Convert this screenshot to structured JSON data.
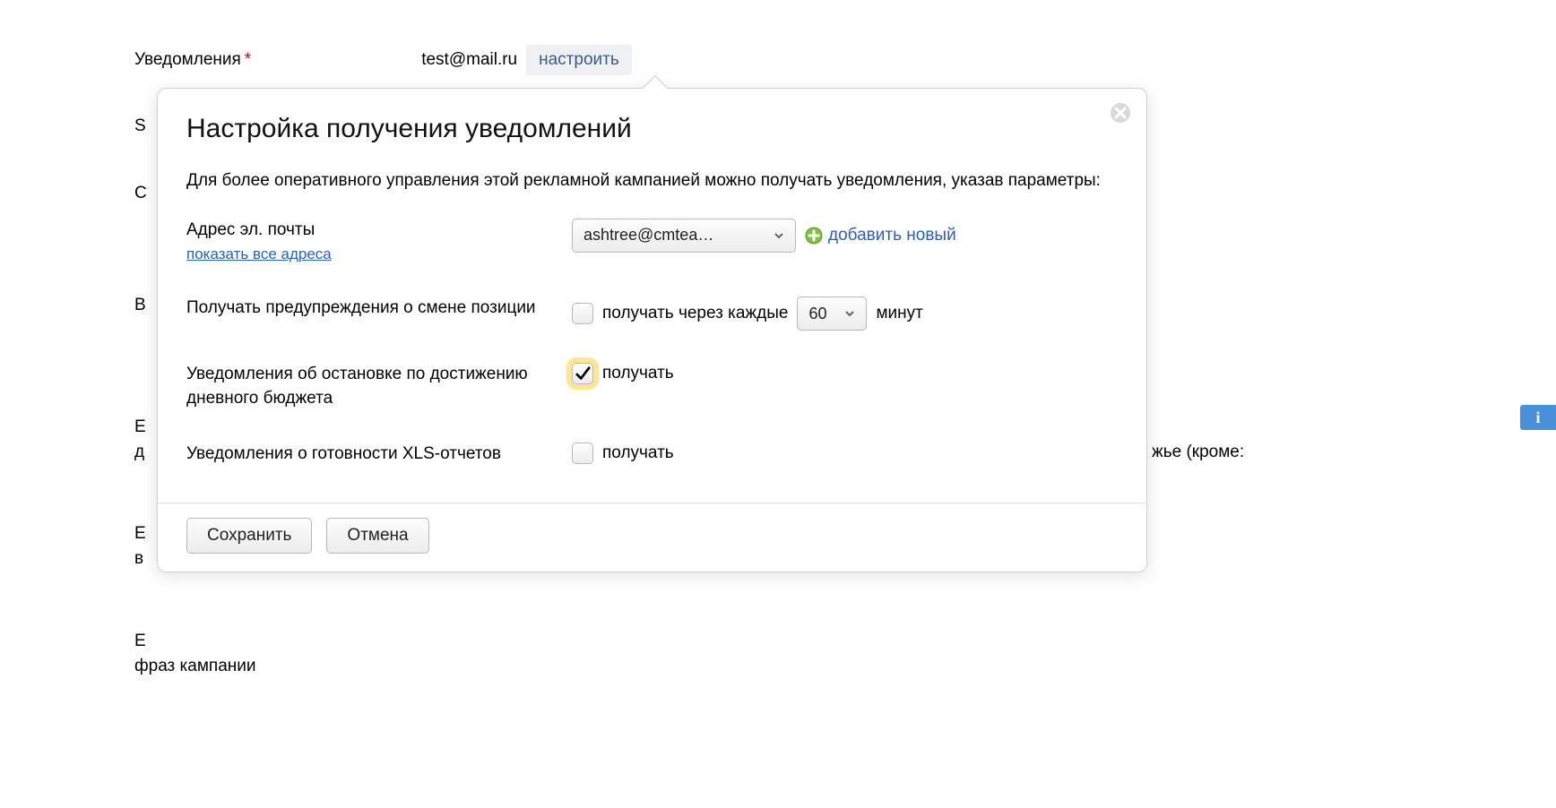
{
  "background": {
    "notifications_label": "Уведомления",
    "notifications_email": "test@mail.ru",
    "configure_btn": "настроить",
    "row_s": "S",
    "row_c": "С",
    "row_b": "В",
    "row_e1a": "Е",
    "row_e1b": "д",
    "row_e2a": "Е",
    "row_e2b": "в",
    "row_e3a": "Е",
    "row_e3b": "фраз кампании",
    "trail_text": "жье (кроме:",
    "info_badge": "i"
  },
  "modal": {
    "title": "Настройка получения уведомлений",
    "description": "Для более оперативного управления этой рекламной кампанией можно получать уведомления, указав параметры:",
    "email_label": "Адрес эл. почты",
    "show_all": "показать все адреса",
    "email_select": "ashtree@cmtea…",
    "add_new": "добавить новый",
    "position_label": "Получать предупреждения о смене позиции",
    "position_chk_label": "получать через каждые",
    "interval_value": "60",
    "interval_unit": "минут",
    "budget_label": "Уведомления об остановке по достижению дневного бюджета",
    "budget_chk_label": "получать",
    "xls_label": "Уведомления о готовности XLS-отчетов",
    "xls_chk_label": "получать",
    "save_btn": "Сохранить",
    "cancel_btn": "Отмена"
  }
}
